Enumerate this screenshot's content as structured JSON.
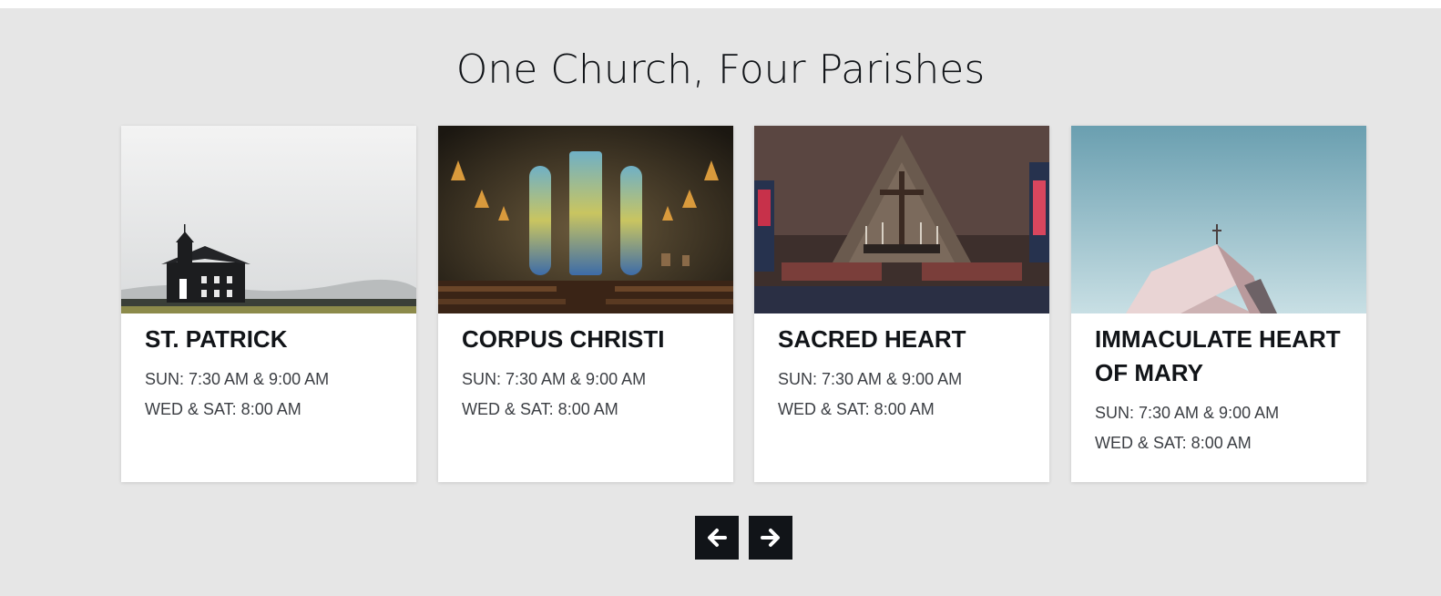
{
  "section": {
    "title": "One Church, Four Parishes"
  },
  "parishes": [
    {
      "name": "ST. PATRICK",
      "sunday": "SUN: 7:30 AM & 9:00 AM",
      "weekday": "WED & SAT: 8:00 AM",
      "image": "black-church-in-field-photo"
    },
    {
      "name": "CORPUS CHRISTI",
      "sunday": "SUN: 7:30 AM & 9:00 AM",
      "weekday": "WED & SAT: 8:00 AM",
      "image": "stained-glass-interior-photo"
    },
    {
      "name": "SACRED HEART",
      "sunday": "SUN: 7:30 AM & 9:00 AM",
      "weekday": "WED & SAT: 8:00 AM",
      "image": "altar-with-cross-photo"
    },
    {
      "name": "IMMACULATE HEART OF MARY",
      "sunday": "SUN: 7:30 AM & 9:00 AM",
      "weekday": "WED & SAT: 8:00 AM",
      "image": "church-roof-sky-photo"
    }
  ],
  "carousel": {
    "prev_icon": "arrow-left-icon",
    "next_icon": "arrow-right-icon"
  },
  "colors": {
    "background": "#e6e6e6",
    "card": "#ffffff",
    "heading": "#111418",
    "body_text": "#3c3f44",
    "button": "#111418",
    "button_icon": "#ffffff"
  }
}
